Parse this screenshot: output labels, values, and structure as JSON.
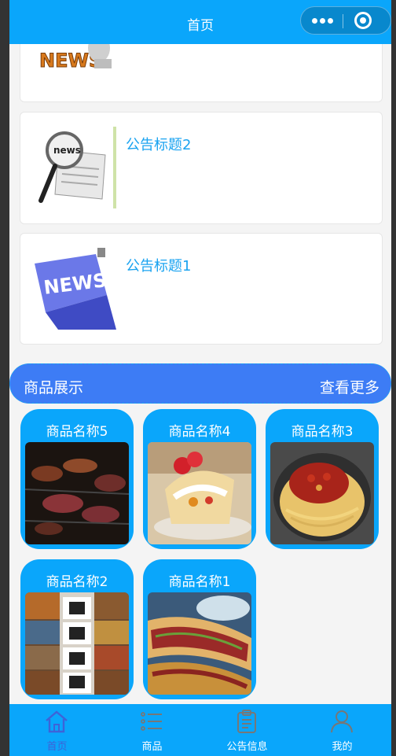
{
  "header": {
    "title": "首页"
  },
  "notices": [
    {
      "title": ""
    },
    {
      "title": "公告标题2"
    },
    {
      "title": "公告标题1"
    }
  ],
  "section": {
    "title": "商品展示",
    "more": "查看更多"
  },
  "products": [
    {
      "name": "商品名称5"
    },
    {
      "name": "商品名称4"
    },
    {
      "name": "商品名称3"
    },
    {
      "name": "商品名称2"
    },
    {
      "name": "商品名称1"
    }
  ],
  "tabbar": {
    "items": [
      {
        "label": "首页",
        "icon": "home-icon",
        "active": true
      },
      {
        "label": "商品",
        "icon": "list-icon",
        "active": false
      },
      {
        "label": "公告信息",
        "icon": "clipboard-icon",
        "active": false
      },
      {
        "label": "我的",
        "icon": "user-icon",
        "active": false
      }
    ]
  },
  "colors": {
    "primary": "#0aa6fb",
    "section": "#3d7cf5",
    "link": "#1aa3f0",
    "active_tab": "#3d63d8"
  }
}
